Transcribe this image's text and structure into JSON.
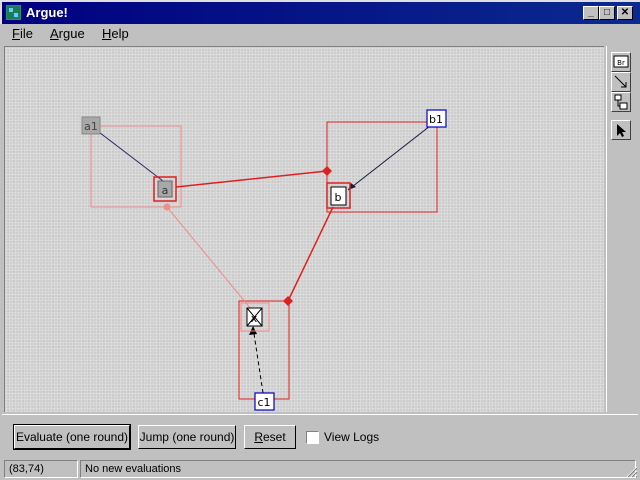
{
  "window": {
    "title": "Argue!"
  },
  "menu": {
    "file": "File",
    "argue": "Argue",
    "help": "Help"
  },
  "graph": {
    "nodes": {
      "a1": "a1",
      "a": "a",
      "b": "b",
      "b1": "b1",
      "x": "x",
      "c1": "c1"
    }
  },
  "palette": {
    "tool_br_label": "Br"
  },
  "toolbar": {
    "evaluate_label": "Evaluate (one round)",
    "jump_label": "Jump (one round)",
    "reset_label": "Reset",
    "view_logs_label": "View Logs",
    "view_logs_checked": false
  },
  "status": {
    "coords": "(83,74)",
    "message": "No new evaluations"
  },
  "colors": {
    "title_bar": "#000080",
    "attack_edge": "#e02020",
    "faded_edge": "#f08c8c",
    "support_edge": "#1a1a60",
    "input_node_border": "#0000cc"
  }
}
